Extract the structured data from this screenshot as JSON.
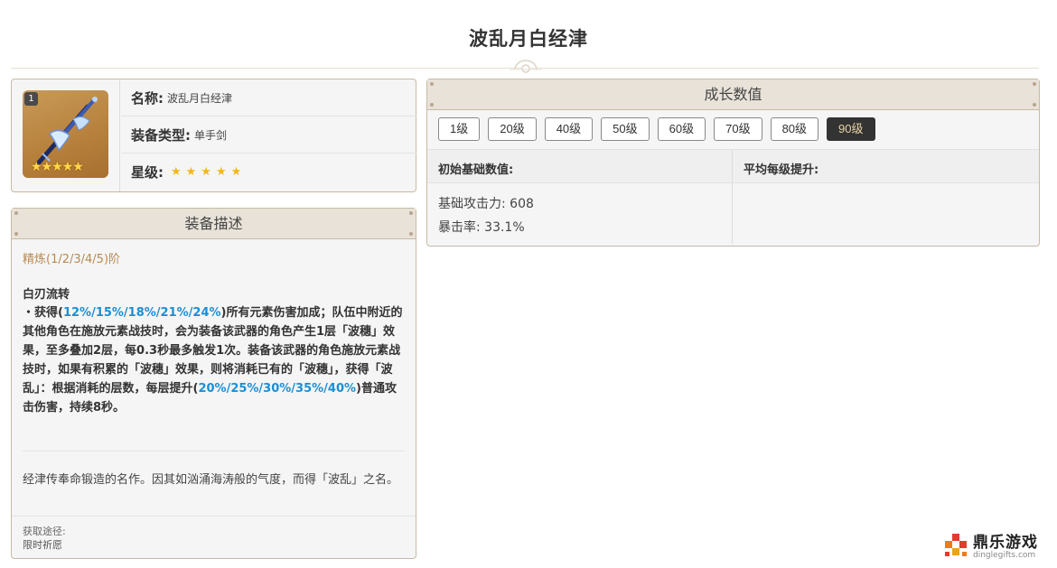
{
  "page": {
    "title": "波乱月白经津"
  },
  "info": {
    "refine_badge": "1",
    "name_label": "名称:",
    "name_value": "波乱月白经津",
    "type_label": "装备类型:",
    "type_value": "单手剑",
    "rarity_label": "星级:",
    "rarity_stars": "★★★★★",
    "rarity_count": 5
  },
  "description": {
    "header": "装备描述",
    "refine_label": "精炼(1/2/3/4/5)阶",
    "skill_name": "白刃流转",
    "skill_p1": "・获得(",
    "skill_v1": "12%/15%/18%/21%/24%",
    "skill_p2": ")所有元素伤害加成；队伍中附近的其他角色在施放元素战技时，会为装备该武器的角色产生1层「波穗」效果，至多叠加2层，每0.3秒最多触发1次。装备该武器的角色施放元素战技时，如果有积累的「波穗」效果，则将消耗已有的「波穗」，获得「波乱」：根据消耗的层数，每层提升(",
    "skill_v2": "20%/25%/30%/35%/40%",
    "skill_p3": ")普通攻击伤害，持续8秒。",
    "lore": "经津传奉命锻造的名作。因其如汹涌海涛般的气度，而得「波乱」之名。",
    "source_label": "获取途径:",
    "source_value": "限时祈愿"
  },
  "growth": {
    "header": "成长数值",
    "levels": [
      "1级",
      "20级",
      "40级",
      "50级",
      "60级",
      "70级",
      "80级",
      "90级"
    ],
    "active_level": "90级",
    "base_label": "初始基础数值:",
    "avg_label": "平均每级提升:",
    "stat_atk": "基础攻击力: 608",
    "stat_crit": "暴击率: 33.1%"
  },
  "watermark": {
    "title": "鼎乐游戏",
    "url": "dinglegifts.com"
  },
  "colors": {
    "highlight": "#1a8fd6",
    "refine": "#b98a52",
    "active_bg": "#333333",
    "active_text": "#e8d3a6",
    "star": "#f3b71c"
  },
  "icons": {
    "weapon": "sword-image",
    "ornament": "divider-ornament",
    "logo": "dingle-logo-icon"
  }
}
